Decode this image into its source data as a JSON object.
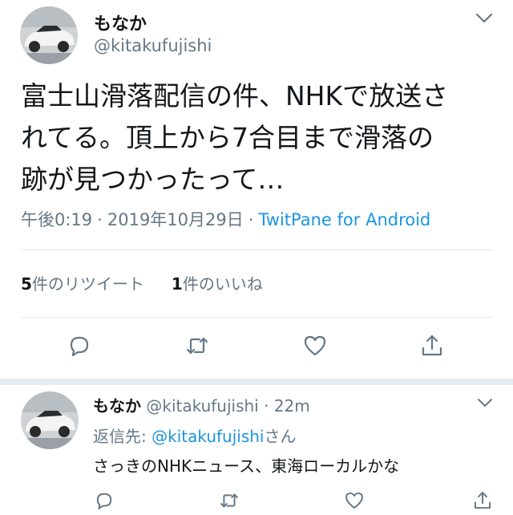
{
  "colors": {
    "text": "#14171a",
    "secondary": "#657786",
    "link": "#1b95e0",
    "divider": "#e1e8ed"
  },
  "main_tweet": {
    "display_name": "もなか",
    "handle": "@kitakufujishi",
    "text_lines": [
      "富士山滑落配信の件、NHKで放送さ",
      "れてる。頂上から7合目まで滑落の",
      "跡が見つかったって…"
    ],
    "time": "午後0:19",
    "separator": "·",
    "date": "2019年10月29日",
    "source": "TwitPane for Android",
    "retweet_count": "5",
    "retweet_label": "件のリツイート",
    "like_count": "1",
    "like_label": "件のいいね",
    "icons": [
      "chevron-down-icon",
      "reply-icon",
      "retweet-icon",
      "like-icon",
      "share-icon"
    ]
  },
  "reply_tweet": {
    "display_name": "もなか",
    "handle": "@kitakufujishi",
    "separator": "·",
    "age": "22m",
    "reply_prefix": "返信先: ",
    "reply_mention": "@kitakufujishi",
    "reply_suffix": "さん",
    "text": "さっきのNHKニュース、東海ローカルかな",
    "icons": [
      "chevron-down-icon",
      "reply-icon",
      "retweet-icon",
      "like-icon",
      "share-icon"
    ]
  }
}
